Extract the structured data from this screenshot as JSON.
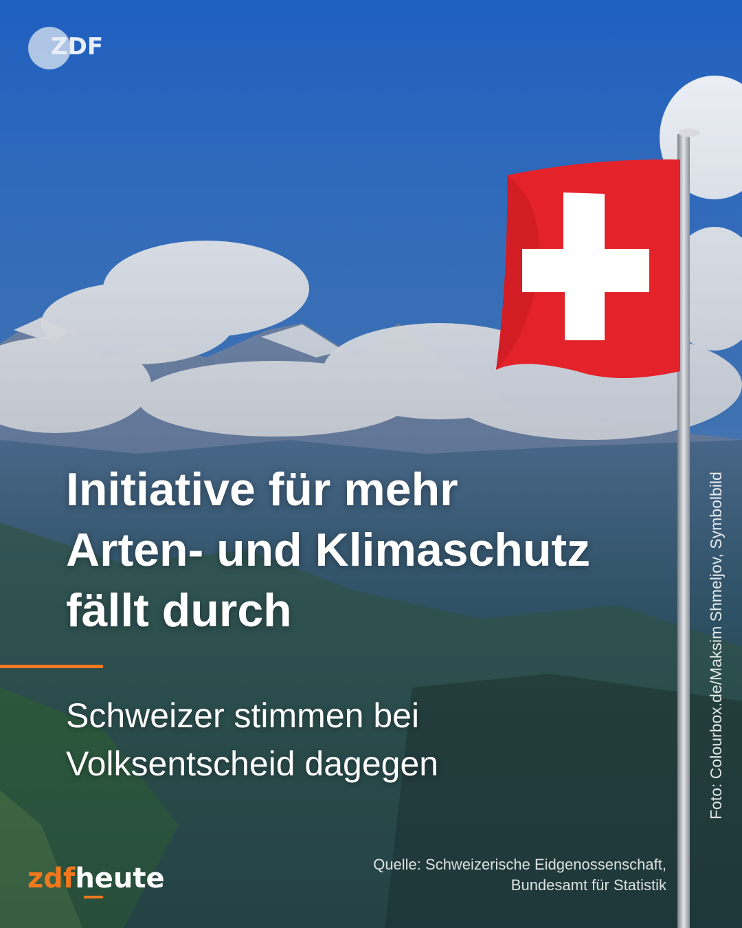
{
  "logo": {
    "text": "ZDF"
  },
  "headline": {
    "lines": [
      "Initiative für mehr",
      "Arten- und Klimaschutz",
      "fällt durch"
    ]
  },
  "subline": {
    "lines": [
      "Schweizer stimmen bei",
      "Volksentscheid dagegen"
    ]
  },
  "photo_credit": "Foto: Colourbox.de/Maksim Shmeljov, Symbolbild",
  "source": {
    "lines": [
      "Quelle: Schweizerische Eidgenossenschaft,",
      "Bundesamt für Statistik"
    ]
  },
  "brand": {
    "part1": "zdf",
    "part2": "heute"
  },
  "colors": {
    "accent": "#f2781e",
    "flag_red": "#e4222a",
    "text": "#ffffff",
    "sky": "#2f6cc0"
  }
}
